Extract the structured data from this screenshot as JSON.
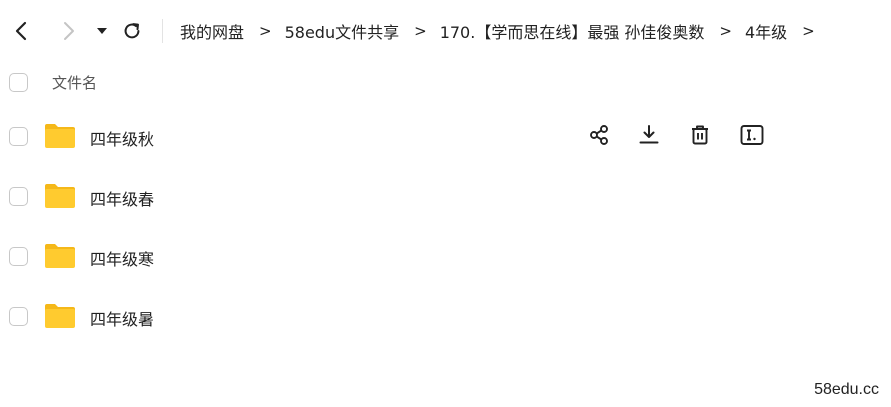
{
  "toolbar": {
    "back_icon": "chevron-left-icon",
    "forward_icon": "chevron-right-icon",
    "history_icon": "caret-down-icon",
    "refresh_icon": "refresh-icon"
  },
  "breadcrumb": {
    "items": [
      "我的网盘",
      "58edu文件共享",
      "170.【学而思在线】最强 孙佳俊奥数",
      "4年级"
    ],
    "separator": ">"
  },
  "list": {
    "column_name": "文件名",
    "items": [
      {
        "name": "四年级秋",
        "type": "folder"
      },
      {
        "name": "四年级春",
        "type": "folder"
      },
      {
        "name": "四年级寒",
        "type": "folder"
      },
      {
        "name": "四年级暑",
        "type": "folder"
      }
    ]
  },
  "row_actions": [
    "share-icon",
    "download-icon",
    "delete-icon",
    "rename-icon"
  ],
  "colors": {
    "folder": "#FFCB2F",
    "folder_tab": "#F5B819",
    "text": "#222222",
    "checkbox_border": "#c8c8c8"
  },
  "watermark": "58edu.cc"
}
